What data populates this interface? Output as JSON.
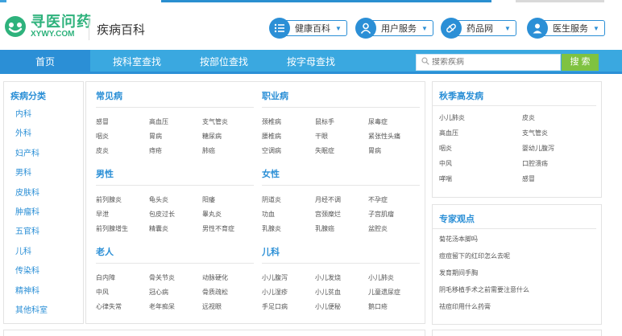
{
  "header": {
    "logo_cn": "寻医问药",
    "logo_en": "XYWY.COM",
    "site_title": "疾病百科",
    "services": [
      {
        "label": "健康百科",
        "icon": "list-icon"
      },
      {
        "label": "用户服务",
        "icon": "user-icon"
      },
      {
        "label": "药品网",
        "icon": "pill-icon"
      },
      {
        "label": "医生服务",
        "icon": "doctor-icon"
      }
    ]
  },
  "nav": {
    "items": [
      "首页",
      "按科室查找",
      "按部位查找",
      "按字母查找"
    ],
    "search_placeholder": "搜索疾病",
    "search_button": "搜 索"
  },
  "sidebar": {
    "title": "疾病分类",
    "items": [
      "内科",
      "外科",
      "妇产科",
      "男科",
      "皮肤科",
      "肿瘤科",
      "五官科",
      "儿科",
      "传染科",
      "精神科",
      "其他科室"
    ]
  },
  "sections": {
    "common": {
      "title": "常见病",
      "items": [
        "感冒",
        "高血压",
        "支气管炎",
        "咽炎",
        "胃病",
        "糖尿病",
        "皮炎",
        "痔疮",
        "肺癌"
      ]
    },
    "occupational": {
      "title": "职业病",
      "items": [
        "颈椎病",
        "鼠标手",
        "尿毒症",
        "腰椎病",
        "干眼",
        "紧张性头痛",
        "空调病",
        "失眠症",
        "胃病"
      ]
    },
    "male": {
      "title": "男性",
      "items": [
        "前列腺炎",
        "龟头炎",
        "阳痿",
        "早泄",
        "包皮过长",
        "睾丸炎",
        "前列腺增生",
        "精囊炎",
        "男性不育症"
      ]
    },
    "female": {
      "title": "女性",
      "items": [
        "阴道炎",
        "月经不调",
        "不孕症",
        "功血",
        "宫颈糜烂",
        "子宫肌瘤",
        "乳腺炎",
        "乳腺癌",
        "盆腔炎"
      ]
    },
    "elderly": {
      "title": "老人",
      "items": [
        "白内障",
        "骨关节炎",
        "动脉硬化",
        "中风",
        "冠心病",
        "骨质疏松",
        "心律失常",
        "老年痴呆",
        "远视眼"
      ]
    },
    "children": {
      "title": "儿科",
      "items": [
        "小儿腹泻",
        "小儿发烧",
        "小儿肺炎",
        "小儿湿疹",
        "小儿贫血",
        "儿童遗尿症",
        "手足口病",
        "小儿便秘",
        "鹅口疮"
      ]
    }
  },
  "seasonal": {
    "title": "秋季高发病",
    "items": [
      "小儿肺炎",
      "皮炎",
      "高血压",
      "支气管炎",
      "咽炎",
      "婴幼儿腹泻",
      "中风",
      "口腔溃疡",
      "哮喘",
      "感冒"
    ]
  },
  "expert": {
    "title": "专家观点",
    "items": [
      "菊花汤本脚吗",
      "痘痘留下的红印怎么去呢",
      "发育期间手胸",
      "阴毛移植手术之前需要注意什么",
      "祛痘印用什么药膏"
    ]
  },
  "colors": {
    "accent": "#2b8fd6",
    "nav": "#3aa8e0",
    "brand": "#2eb27c",
    "search_button": "#7fc241"
  }
}
